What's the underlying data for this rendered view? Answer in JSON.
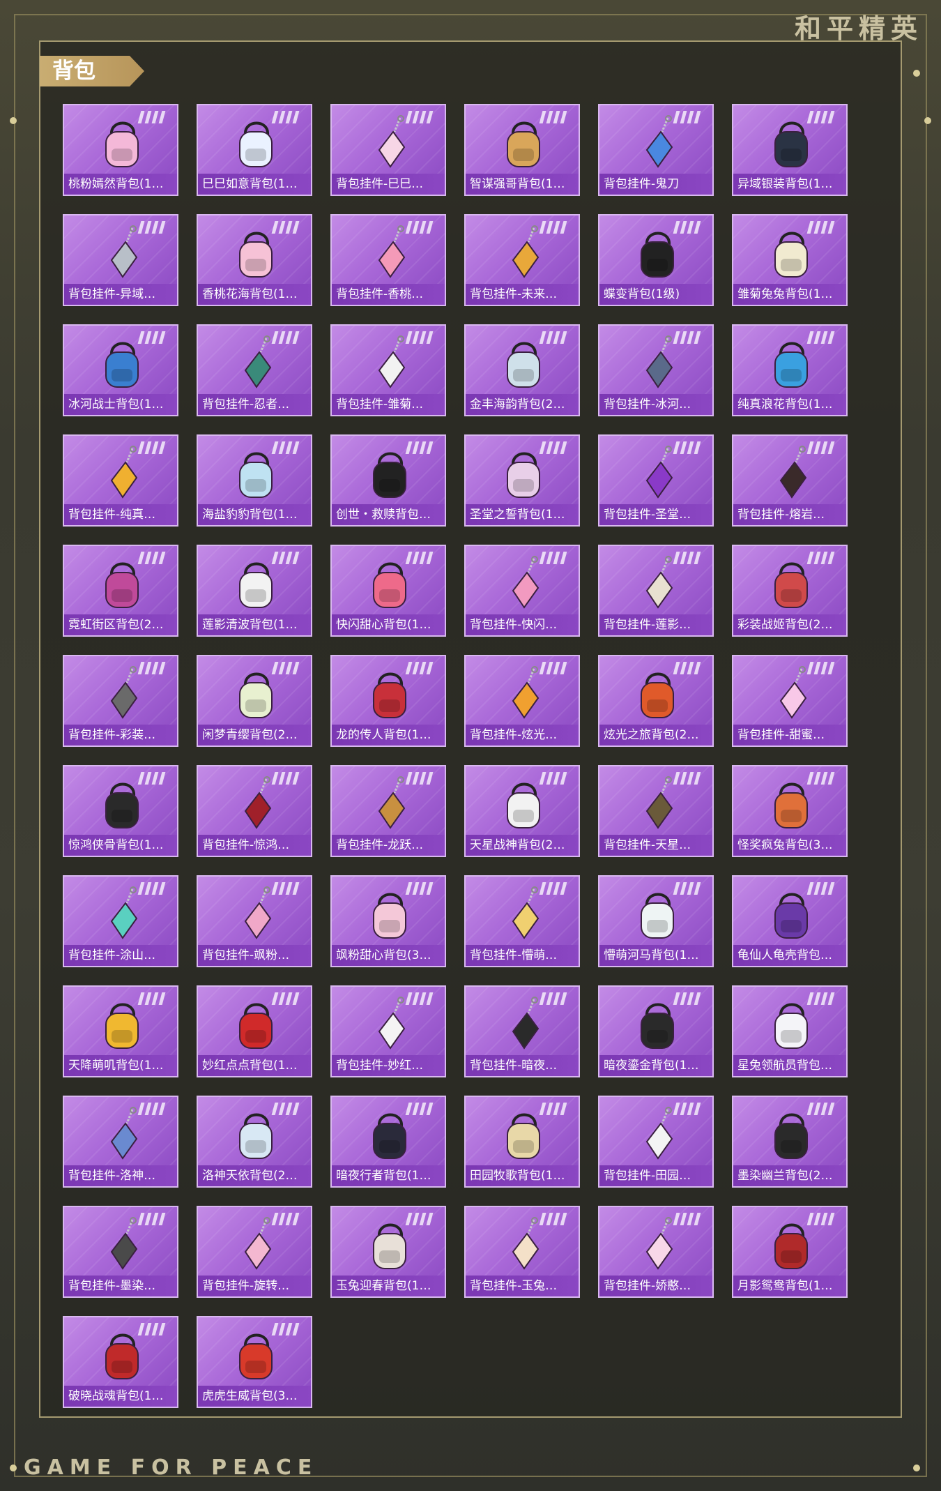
{
  "brand": "和平精英",
  "footer_brand": "GAME FOR PEACE",
  "section_tab": "背包",
  "items": [
    {
      "label": "桃粉嫣然背包(1…",
      "icon": "backpack-icon",
      "color": "#f4b8d8"
    },
    {
      "label": "巳巳如意背包(1…",
      "icon": "backpack-icon",
      "color": "#eaf2ff"
    },
    {
      "label": "背包挂件-巳巳…",
      "icon": "pendant-icon",
      "color": "#f7d6e6"
    },
    {
      "label": "智谋强哥背包(1…",
      "icon": "backpack-icon",
      "color": "#d9a65a"
    },
    {
      "label": "背包挂件-鬼刀",
      "icon": "pendant-icon",
      "color": "#4a88e0"
    },
    {
      "label": "异域银装背包(1…",
      "icon": "backpack-icon",
      "color": "#2a3344"
    },
    {
      "label": "背包挂件-异域…",
      "icon": "pendant-icon",
      "color": "#b8bfc8"
    },
    {
      "label": "香桃花海背包(1…",
      "icon": "backpack-icon",
      "color": "#f6c2d6"
    },
    {
      "label": "背包挂件-香桃…",
      "icon": "pendant-icon",
      "color": "#f49ab8"
    },
    {
      "label": "背包挂件-未来…",
      "icon": "pendant-icon",
      "color": "#e8a83a"
    },
    {
      "label": "蝶变背包(1级)",
      "icon": "backpack-icon",
      "color": "#222222"
    },
    {
      "label": "雏菊兔兔背包(1…",
      "icon": "backpack-icon",
      "color": "#f1ead0"
    },
    {
      "label": "冰河战士背包(1…",
      "icon": "backpack-icon",
      "color": "#3a7fd0"
    },
    {
      "label": "背包挂件-忍者…",
      "icon": "pendant-icon",
      "color": "#3a8a7a"
    },
    {
      "label": "背包挂件-雏菊…",
      "icon": "pendant-icon",
      "color": "#f2f2f2"
    },
    {
      "label": "金丰海韵背包(2…",
      "icon": "backpack-icon",
      "color": "#cfe0ea"
    },
    {
      "label": "背包挂件-冰河…",
      "icon": "pendant-icon",
      "color": "#5a6a8a"
    },
    {
      "label": "纯真浪花背包(1…",
      "icon": "backpack-icon",
      "color": "#3aa0e0"
    },
    {
      "label": "背包挂件-纯真…",
      "icon": "pendant-icon",
      "color": "#f0b030"
    },
    {
      "label": "海盐豹豹背包(1…",
      "icon": "backpack-icon",
      "color": "#bfe2f2"
    },
    {
      "label": "创世・救赎背包…",
      "icon": "backpack-icon",
      "color": "#222222"
    },
    {
      "label": "圣堂之誓背包(1…",
      "icon": "backpack-icon",
      "color": "#e8cfe8"
    },
    {
      "label": "背包挂件-圣堂…",
      "icon": "pendant-icon",
      "color": "#8a3ac8"
    },
    {
      "label": "背包挂件-熔岩…",
      "icon": "pendant-icon",
      "color": "#3a2a2a"
    },
    {
      "label": "霓虹街区背包(2…",
      "icon": "backpack-icon",
      "color": "#c04a9a"
    },
    {
      "label": "莲影清波背包(1…",
      "icon": "backpack-icon",
      "color": "#f2f2f2"
    },
    {
      "label": "快闪甜心背包(1…",
      "icon": "backpack-icon",
      "color": "#ee6a8a"
    },
    {
      "label": "背包挂件-快闪…",
      "icon": "pendant-icon",
      "color": "#f29ac0"
    },
    {
      "label": "背包挂件-莲影…",
      "icon": "pendant-icon",
      "color": "#e8e0d0"
    },
    {
      "label": "彩装战姬背包(2…",
      "icon": "backpack-icon",
      "color": "#d04a4a"
    },
    {
      "label": "背包挂件-彩装…",
      "icon": "pendant-icon",
      "color": "#6a6a6a"
    },
    {
      "label": "闲梦青缨背包(2…",
      "icon": "backpack-icon",
      "color": "#e8f0d0"
    },
    {
      "label": "龙的传人背包(1…",
      "icon": "backpack-icon",
      "color": "#c8303a"
    },
    {
      "label": "背包挂件-炫光…",
      "icon": "pendant-icon",
      "color": "#f0a030"
    },
    {
      "label": "炫光之旅背包(2…",
      "icon": "backpack-icon",
      "color": "#e05a2a"
    },
    {
      "label": "背包挂件-甜蜜…",
      "icon": "pendant-icon",
      "color": "#f8c8e8"
    },
    {
      "label": "惊鸿侠骨背包(1…",
      "icon": "backpack-icon",
      "color": "#2a2a2a"
    },
    {
      "label": "背包挂件-惊鸿…",
      "icon": "pendant-icon",
      "color": "#a0202a"
    },
    {
      "label": "背包挂件-龙跃…",
      "icon": "pendant-icon",
      "color": "#c89040"
    },
    {
      "label": "天星战神背包(2…",
      "icon": "backpack-icon",
      "color": "#f2f2f2"
    },
    {
      "label": "背包挂件-天星…",
      "icon": "pendant-icon",
      "color": "#6a5a3a"
    },
    {
      "label": "怪奖疯兔背包(3…",
      "icon": "backpack-icon",
      "color": "#e0703a"
    },
    {
      "label": "背包挂件-涂山…",
      "icon": "pendant-icon",
      "color": "#5ad0c0"
    },
    {
      "label": "背包挂件-飒粉…",
      "icon": "pendant-icon",
      "color": "#f0a8c8"
    },
    {
      "label": "飒粉甜心背包(3…",
      "icon": "backpack-icon",
      "color": "#f4c8d8"
    },
    {
      "label": "背包挂件-懵萌…",
      "icon": "pendant-icon",
      "color": "#f0d070"
    },
    {
      "label": "懵萌河马背包(1…",
      "icon": "backpack-icon",
      "color": "#eef4f4"
    },
    {
      "label": "龟仙人龟壳背包…",
      "icon": "backpack-icon",
      "color": "#6a3aa8"
    },
    {
      "label": "天降萌叽背包(1…",
      "icon": "backpack-icon",
      "color": "#f0b830"
    },
    {
      "label": "妙红点点背包(1…",
      "icon": "backpack-icon",
      "color": "#d02a2a"
    },
    {
      "label": "背包挂件-妙红…",
      "icon": "pendant-icon",
      "color": "#f4f4f4"
    },
    {
      "label": "背包挂件-暗夜…",
      "icon": "pendant-icon",
      "color": "#2a2a2a"
    },
    {
      "label": "暗夜鎏金背包(1…",
      "icon": "backpack-icon",
      "color": "#2a2a2a"
    },
    {
      "label": "星兔领航员背包…",
      "icon": "backpack-icon",
      "color": "#f4f4f8"
    },
    {
      "label": "背包挂件-洛神…",
      "icon": "pendant-icon",
      "color": "#6a8ad0"
    },
    {
      "label": "洛神天依背包(2…",
      "icon": "backpack-icon",
      "color": "#d8e8f4"
    },
    {
      "label": "暗夜行者背包(1…",
      "icon": "backpack-icon",
      "color": "#2a2a3a"
    },
    {
      "label": "田园牧歌背包(1…",
      "icon": "backpack-icon",
      "color": "#e8d8a8"
    },
    {
      "label": "背包挂件-田园…",
      "icon": "pendant-icon",
      "color": "#f4f4f4"
    },
    {
      "label": "墨染幽兰背包(2…",
      "icon": "backpack-icon",
      "color": "#2a2a2a"
    },
    {
      "label": "背包挂件-墨染…",
      "icon": "pendant-icon",
      "color": "#4a4a4a"
    },
    {
      "label": "背包挂件-旋转…",
      "icon": "pendant-icon",
      "color": "#f4b8d0"
    },
    {
      "label": "玉兔迎春背包(1…",
      "icon": "backpack-icon",
      "color": "#e8e0d8"
    },
    {
      "label": "背包挂件-玉兔…",
      "icon": "pendant-icon",
      "color": "#f4e0c8"
    },
    {
      "label": "背包挂件-娇憨…",
      "icon": "pendant-icon",
      "color": "#f8d8e8"
    },
    {
      "label": "月影鸳鸯背包(1…",
      "icon": "backpack-icon",
      "color": "#b02a2a"
    },
    {
      "label": "破晓战魂背包(1…",
      "icon": "backpack-icon",
      "color": "#c02a2a"
    },
    {
      "label": "虎虎生威背包(3…",
      "icon": "backpack-icon",
      "color": "#d83a2a"
    }
  ]
}
